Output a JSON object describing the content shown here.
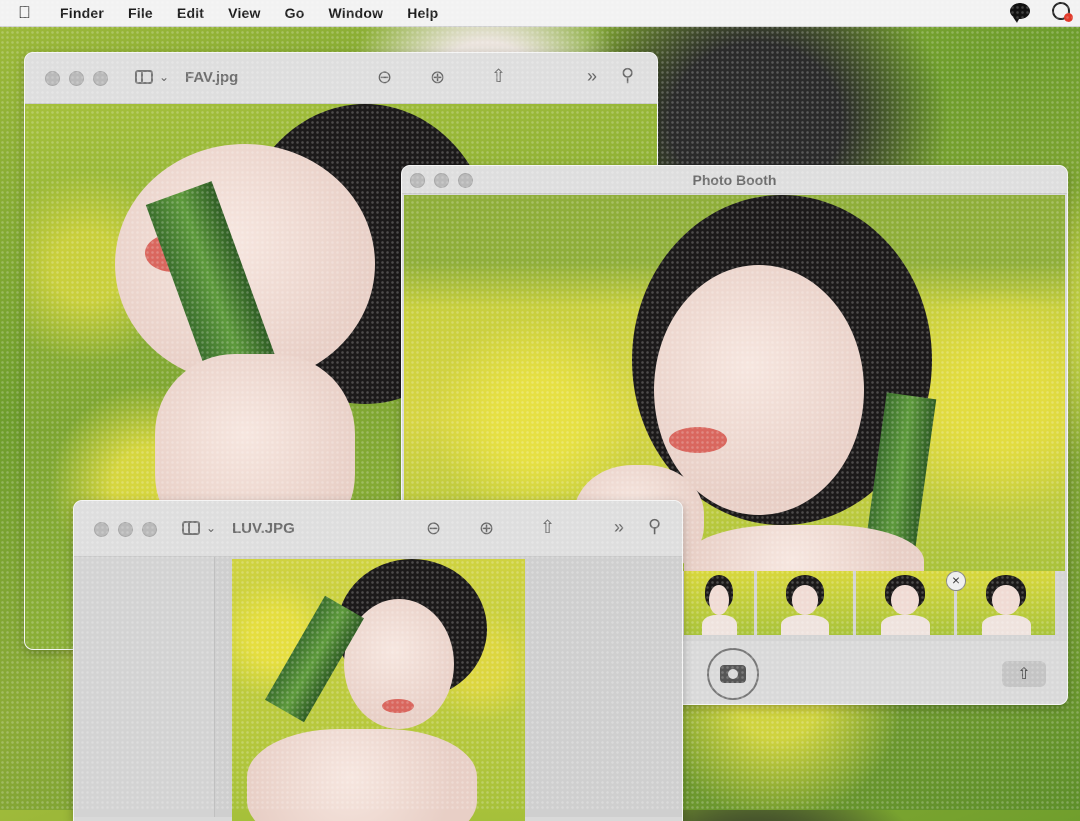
{
  "menubar": {
    "app_name": "Finder",
    "items": [
      "File",
      "Edit",
      "View",
      "Go",
      "Window",
      "Help"
    ]
  },
  "window_fav": {
    "title": "FAV.jpg"
  },
  "window_photobooth": {
    "title": "Photo Booth"
  },
  "window_luv": {
    "title": "LUV.JPG"
  },
  "icons": {
    "apple": "apple-icon",
    "messages": "chat-bubble-icon",
    "control": "control-center-icon",
    "zoom_out": "zoom-out-icon",
    "zoom_in": "zoom-in-icon",
    "share": "share-icon",
    "more": "chevron-double-right-icon",
    "search": "search-icon",
    "camera": "camera-icon"
  },
  "colors": {
    "menubar": "#f2f2f2",
    "window_chrome": "#d9d9d9",
    "grass": "#7fa833",
    "flowers": "#e2de4a"
  }
}
